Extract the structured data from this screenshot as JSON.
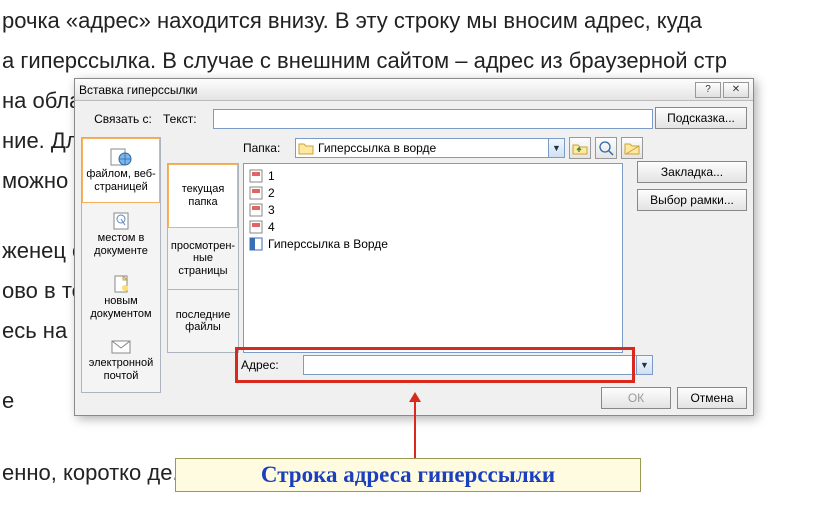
{
  "bg_lines": [
    "рочка «адрес» находится внизу. В эту строку мы вносим адрес, куда",
    "а гиперссылка. В случае с внешним сайтом – адрес из браузерной стр",
    "на обла                                                                                                                   а – то",
    "ние. Дл                                                                                                                   нам пр",
    "можно",
    "женец                                                                                                                     ой кно",
    "ово в те                                                                                                                   ту же п",
    "есь на н",
    "е",
    "енно, коротко                                                                                             де. Получайте уд"
  ],
  "dialog": {
    "title": "Вставка гиперссылки",
    "link_with": "Связать с:",
    "text_label": "Текст:",
    "folder_label": "Папка:",
    "folder_value": "Гиперссылка в ворде",
    "hint_btn": "Подсказка...",
    "bookmark_btn": "Закладка...",
    "frame_btn": "Выбор рамки...",
    "address_label": "Адрес:",
    "address_value": "",
    "ok": "ОК",
    "cancel": "Отмена",
    "left_items": [
      "файлом, веб-страницей",
      "местом в документе",
      "новым документом",
      "электронной почтой"
    ],
    "inner_tabs": [
      "текущая папка",
      "просмотрен-ные страницы",
      "последние файлы"
    ],
    "files": [
      {
        "type": "html",
        "name": "1"
      },
      {
        "type": "html",
        "name": "2"
      },
      {
        "type": "html",
        "name": "3"
      },
      {
        "type": "html",
        "name": "4"
      },
      {
        "type": "doc",
        "name": "Гиперссылка в Ворде"
      }
    ]
  },
  "callout": "Строка адреса гиперссылки"
}
